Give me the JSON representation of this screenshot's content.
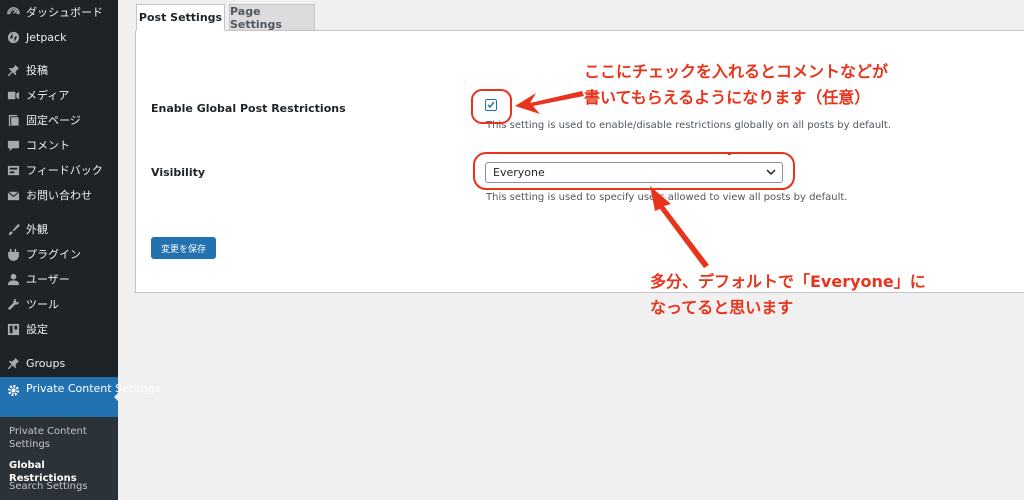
{
  "sidebar": {
    "items": [
      {
        "label": "ダッシュボード",
        "icon": "dashboard-icon"
      },
      {
        "label": "Jetpack",
        "icon": "jetpack-icon"
      },
      {
        "label": "投稿",
        "icon": "pin-icon"
      },
      {
        "label": "メディア",
        "icon": "media-icon"
      },
      {
        "label": "固定ページ",
        "icon": "page-icon"
      },
      {
        "label": "コメント",
        "icon": "comment-icon"
      },
      {
        "label": "フィードバック",
        "icon": "feedback-icon"
      },
      {
        "label": "お問い合わせ",
        "icon": "mail-icon"
      },
      {
        "label": "外観",
        "icon": "brush-icon"
      },
      {
        "label": "プラグイン",
        "icon": "plugin-icon"
      },
      {
        "label": "ユーザー",
        "icon": "user-icon"
      },
      {
        "label": "ツール",
        "icon": "wrench-icon"
      },
      {
        "label": "設定",
        "icon": "settings-icon"
      },
      {
        "label": "Groups",
        "icon": "pin-icon"
      }
    ],
    "active": {
      "label": "Private Content Settings",
      "icon": "gear-icon"
    },
    "submenu": [
      {
        "label": "Private Content Settings",
        "current": false
      },
      {
        "label": "Global Restrictions",
        "current": true
      },
      {
        "label": "Search Settings",
        "current": false
      }
    ]
  },
  "tabs": [
    {
      "label": "Post Settings",
      "active": true
    },
    {
      "label": "Page Settings",
      "active": false
    }
  ],
  "form": {
    "global_restriction_label": "Enable Global Post Restrictions",
    "global_restriction_checked": true,
    "global_restriction_desc": "This setting is used to enable/disable restrictions globally on all posts by default.",
    "visibility_label": "Visibility",
    "visibility_value": "Everyone",
    "visibility_desc": "This setting is used to specify users allowed to view all posts by default.",
    "save_label": "変更を保存"
  },
  "annotations": {
    "color": "#e8341c",
    "note1_line1": "ここにチェックを入れるとコメントなどが",
    "note1_line2": "書いてもらえるようになります（任意）",
    "note2_line1": "多分、デフォルトで「Everyone」に",
    "note2_line2": "なってると思います"
  },
  "colors": {
    "sidebar_bg": "#1d2327",
    "accent": "#2271b1",
    "annotation": "#e8341c"
  }
}
